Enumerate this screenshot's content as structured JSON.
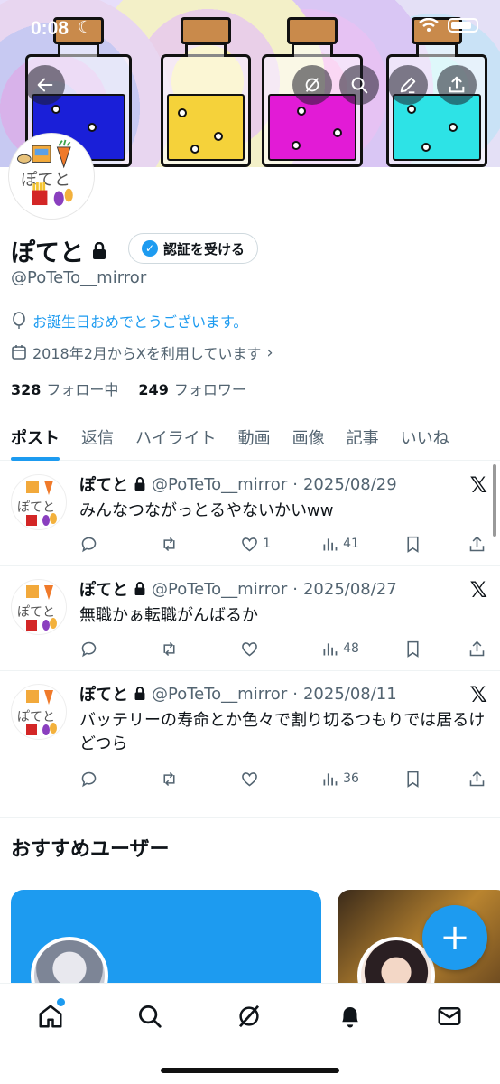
{
  "status_bar": {
    "time": "0:08"
  },
  "profile": {
    "name": "ぽてと",
    "verify_label": "認証を受ける",
    "handle": "@PoTeTo__mirror",
    "birthday": "お誕生日おめでとうございます。",
    "joined": "2018年2月からXを利用しています",
    "following_count": "328",
    "following_label": "フォロー中",
    "followers_count": "249",
    "followers_label": "フォロワー"
  },
  "tabs": [
    {
      "label": "ポスト",
      "active": true
    },
    {
      "label": "返信"
    },
    {
      "label": "ハイライト"
    },
    {
      "label": "動画"
    },
    {
      "label": "画像"
    },
    {
      "label": "記事"
    },
    {
      "label": "いいね"
    }
  ],
  "posts": [
    {
      "name": "ぽてと",
      "handle": "@PoTeTo__mirror",
      "date": "2025/08/29",
      "text": "みんなつながっとるやないかいww",
      "likes": "1",
      "views": "41"
    },
    {
      "name": "ぽてと",
      "handle": "@PoTeTo__mirror",
      "date": "2025/08/27",
      "text": "無職かぁ転職がんばるか",
      "likes": "",
      "views": "48"
    },
    {
      "name": "ぽてと",
      "handle": "@PoTeTo__mirror",
      "date": "2025/08/11",
      "text": "バッテリーの寿命とか色々で割り切るつもりでは居るけどつら",
      "likes": "",
      "views": "36"
    }
  ],
  "recommended": {
    "title": "おすすめユーザー"
  },
  "fab_label": "+",
  "colors": {
    "accent": "#1d9bf0",
    "text": "#0f1419",
    "muted": "#536471"
  }
}
